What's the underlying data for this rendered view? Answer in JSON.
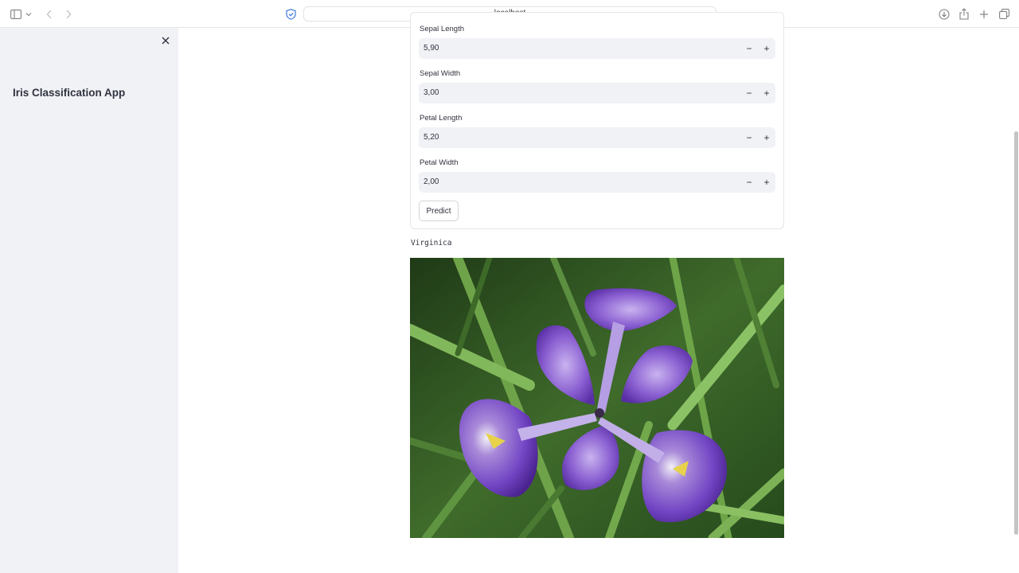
{
  "browser": {
    "url": "localhost",
    "icons": [
      "sidebar-toggle-icon",
      "chevron-down-icon",
      "back-icon",
      "forward-icon",
      "shield-icon",
      "translate-icon",
      "reload-icon",
      "download-icon",
      "share-icon",
      "new-tab-icon",
      "tabs-overview-icon"
    ]
  },
  "sidebar": {
    "title": "Iris Classification App",
    "close_icon": "close-icon"
  },
  "form": {
    "fields": [
      {
        "label": "Sepal Length",
        "value": "5,90"
      },
      {
        "label": "Sepal Width",
        "value": "3,00"
      },
      {
        "label": "Petal Length",
        "value": "5,20"
      },
      {
        "label": "Petal Width",
        "value": "2,00"
      }
    ],
    "stepper_minus": "−",
    "stepper_plus": "+",
    "predict_label": "Predict"
  },
  "result": {
    "prediction": "Virginica"
  },
  "colors": {
    "sidebar_bg": "#f0f2f6",
    "input_bg": "#f0f2f6",
    "text": "#31333f",
    "iris_purple": "#7b52c9"
  }
}
